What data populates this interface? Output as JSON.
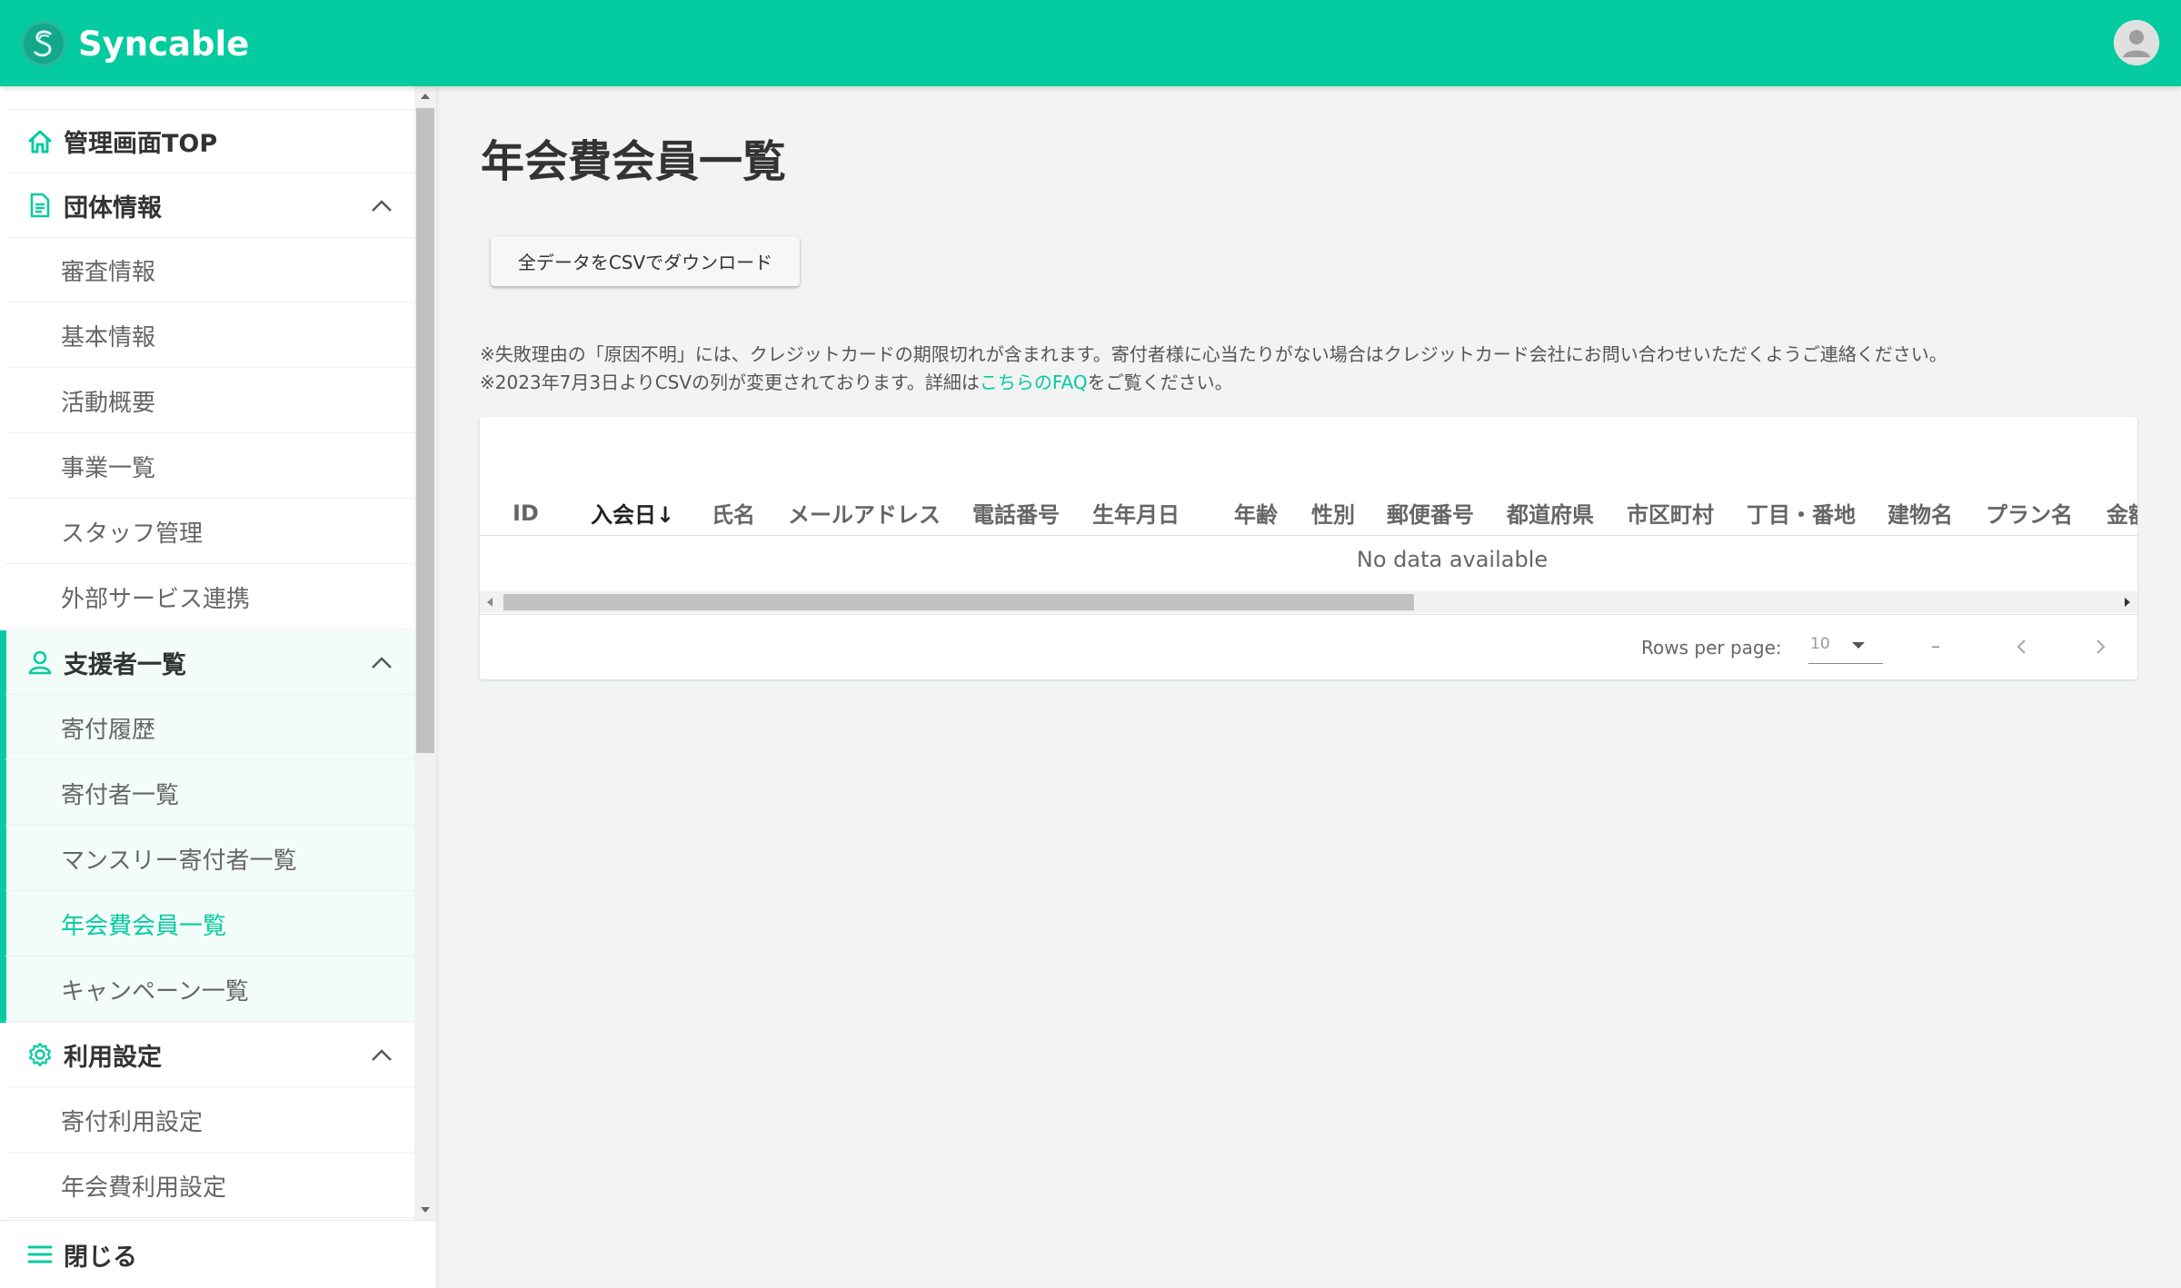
{
  "header": {
    "brand": "Syncable",
    "brand_color": "#04cba0"
  },
  "sidebar": {
    "top": {
      "label": "管理画面TOP",
      "icon": "home-icon"
    },
    "org": {
      "label": "団体情報",
      "icon": "document-icon",
      "items": [
        "審査情報",
        "基本情報",
        "活動概要",
        "事業一覧",
        "スタッフ管理",
        "外部サービス連携"
      ]
    },
    "supporters": {
      "label": "支援者一覧",
      "icon": "person-icon",
      "items": [
        "寄付履歴",
        "寄付者一覧",
        "マンスリー寄付者一覧",
        "年会費会員一覧",
        "キャンペーン一覧"
      ],
      "active_item": "年会費会員一覧"
    },
    "settings": {
      "label": "利用設定",
      "icon": "gear-icon",
      "items": [
        "寄付利用設定",
        "年会費利用設定"
      ]
    },
    "close": {
      "label": "閉じる",
      "icon": "menu-icon"
    }
  },
  "main": {
    "title": "年会費会員一覧",
    "csv_button": "全データをCSVでダウンロード",
    "note1": "※失敗理由の「原因不明」には、クレジットカードの期限切れが含まれます。寄付者様に心当たりがない場合はクレジットカード会社にお問い合わせいただくようご連絡ください。",
    "note2_prefix": "※2023年7月3日よりCSVの列が変更されております。詳細は",
    "note2_link": "こちらのFAQ",
    "note2_suffix": "をご覧ください。"
  },
  "table": {
    "columns": [
      "ID",
      "入会日↓",
      "氏名",
      "メールアドレス",
      "電話番号",
      "生年月日",
      "年齢",
      "性別",
      "郵便番号",
      "都道府県",
      "市区町村",
      "丁目・番地",
      "建物名",
      "プラン名",
      "金額"
    ],
    "sorted_column": "入会日",
    "empty_text": "No data available",
    "rows_per_page_label": "Rows per page:",
    "rows_per_page_value": "10",
    "range_text": "–"
  }
}
